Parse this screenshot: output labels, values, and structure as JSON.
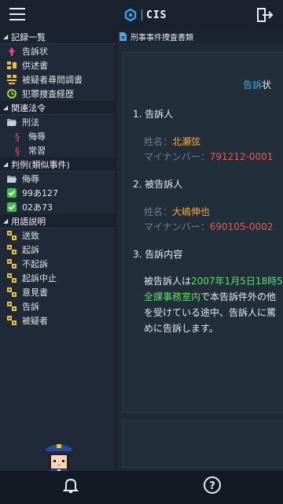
{
  "app": {
    "logo_text": "CIS"
  },
  "sidebar": {
    "records": {
      "title": "記録一覧",
      "items": [
        {
          "label": "告訴状",
          "icon": "complaint-icon"
        },
        {
          "label": "供述書",
          "icon": "statement-icon"
        },
        {
          "label": "被疑者尋問調書",
          "icon": "interrogation-icon"
        },
        {
          "label": "犯罪捜査経歴",
          "icon": "history-icon"
        }
      ]
    },
    "laws": {
      "title": "関連法令",
      "folder": "刑法",
      "items": [
        {
          "label": "侮辱"
        },
        {
          "label": "常習"
        }
      ]
    },
    "cases": {
      "title": "判例(類似事件)",
      "folder": "侮辱",
      "items": [
        {
          "label": "99あ127"
        },
        {
          "label": "02あ73"
        }
      ]
    },
    "terms": {
      "title": "用語説明",
      "items": [
        {
          "label": "送致"
        },
        {
          "label": "起訴"
        },
        {
          "label": "不起訴"
        },
        {
          "label": "起訴中止"
        },
        {
          "label": "意見書"
        },
        {
          "label": "告訴"
        },
        {
          "label": "被疑者"
        }
      ]
    }
  },
  "main": {
    "tab_label": "刑事事件捜査書類",
    "doc_title_highlight": "告訴",
    "doc_title_rest": "状",
    "section1": {
      "heading": "1. 告訴人",
      "name_label": "姓名：",
      "name": "北瀬弦",
      "id_label": "マイナンバー：",
      "id": "791212-0001"
    },
    "section2": {
      "heading": "2. 被告訴人",
      "name_label": "姓名：",
      "name": "大嶋伸也",
      "id_label": "マイナンバー：",
      "id": "690105-0002"
    },
    "section3": {
      "heading": "3. 告訴内容",
      "line1_a": "被告訴人は",
      "line1_b": "2007年1月5日18時5",
      "line2_a": "全課事務室内",
      "line2_b": "で本告訴件外の他",
      "line3": "を受けている途中、告訴人に罵",
      "line4": "めに告訴します。"
    }
  },
  "colors": {
    "accent_blue": "#4aa8e8",
    "name_orange": "#f3a93a",
    "id_red": "#e85a50",
    "highlight_green": "#5be06a"
  }
}
